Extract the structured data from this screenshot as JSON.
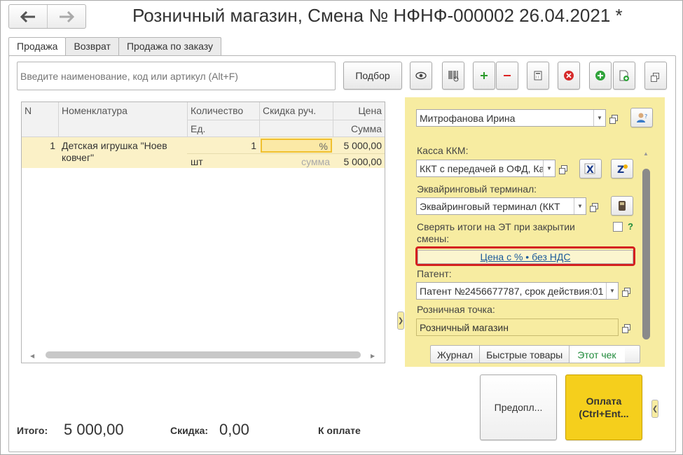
{
  "header": {
    "title": "Розничный магазин, Смена № НФНФ-000002  26.04.2021 *",
    "back_icon": "arrow-left-icon",
    "forward_icon": "arrow-right-icon"
  },
  "tabs": [
    {
      "label": "Продажа",
      "active": true
    },
    {
      "label": "Возврат",
      "active": false
    },
    {
      "label": "Продажа по заказу",
      "active": false
    }
  ],
  "search": {
    "placeholder": "Введите наименование, код или артикул (Alt+F)"
  },
  "toolbar": {
    "podbor_label": "Подбор"
  },
  "table": {
    "headers": {
      "n": "N",
      "nomenclature": "Номенклатура",
      "quantity": "Количество",
      "unit": "Ед.",
      "discount": "Скидка руч.",
      "price": "Цена",
      "sum": "Сумма"
    },
    "rows": [
      {
        "n": "1",
        "nomenclature": "Детская игрушка \"Ноев ковчег\"",
        "quantity": "1",
        "unit": "шт",
        "discount_pct": "%",
        "discount_sum": "сумма",
        "price": "5 000,00",
        "sum": "5 000,00"
      }
    ]
  },
  "right_panel": {
    "cashier": "Митрофанова Ирина",
    "kkm_label": "Касса ККМ:",
    "kkm_value": "ККТ с передачей в ОФД, Ка",
    "terminal_label": "Эквайринговый терминал:",
    "terminal_value": "Эквайринговый терминал  (ККТ",
    "reconcile_label_1": "Сверять итоги на ЭТ при закрытии",
    "reconcile_label_2": "смены:",
    "reconcile_checked": false,
    "help": "?",
    "price_link": "Цена с % • без НДС",
    "patent_label": "Патент:",
    "patent_value": "Патент №2456677787, срок действия:01",
    "retail_label": "Розничная точка:",
    "retail_value": "Розничный магазин",
    "bottom_tabs": [
      {
        "label": "Журнал",
        "active": false
      },
      {
        "label": "Быстрые товары",
        "active": false
      },
      {
        "label": "Этот чек",
        "active": true
      }
    ]
  },
  "actions": {
    "prepay_label": "Предопл...",
    "pay_label_1": "Оплата",
    "pay_label_2": "(Ctrl+Ent..."
  },
  "footer": {
    "total_label": "Итого:",
    "total_value": "5 000,00",
    "discount_label": "Скидка:",
    "discount_value": "0,00",
    "to_pay_label": "К оплате"
  },
  "colors": {
    "accent_yellow": "#f7eca1",
    "pay_button": "#f5cf1c",
    "highlight_row": "#fbf1c7",
    "link": "#1a5a9a",
    "red_frame": "#d42020",
    "green_text": "#1f8a3a"
  }
}
